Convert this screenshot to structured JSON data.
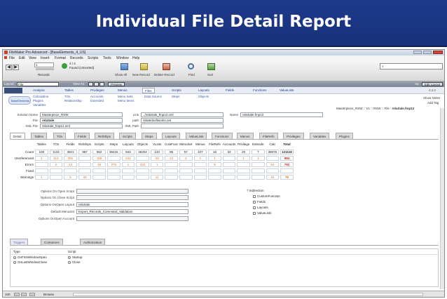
{
  "slide_title": "Individual File Detail Report",
  "window": {
    "title": "FileMaker Pro Advanced - [BaseElements_4_US]"
  },
  "menu": [
    "File",
    "Edit",
    "View",
    "Insert",
    "Format",
    "Records",
    "Scripts",
    "Tools",
    "Window",
    "Help"
  ],
  "toolbar": {
    "record_current": "1",
    "record_total": "4 / 4",
    "found_label": "Found (Unsorted)",
    "records_label": "Records",
    "buttons": [
      "Show All",
      "New Record",
      "Delete Record",
      "Find",
      "Sort"
    ]
  },
  "layoutbar": {
    "layout_label": "Layout:",
    "layout_value": "File",
    "viewas_label": "View As:",
    "preview_label": "Preview",
    "aa": "Aa",
    "edit_layout": "Edit Layout"
  },
  "nav": {
    "tabs": [
      "Analysis",
      "Tables",
      "Privileges",
      "Menus",
      "Files",
      "Scripts",
      "Layouts",
      "Fields",
      "Functions",
      "ValueLists"
    ],
    "sub": [
      [
        "Calculation",
        "Plugins",
        "Variables"
      ],
      [
        "TOs",
        "Relationship"
      ],
      [
        "Accounts",
        "Extended"
      ],
      [
        "Menu Sets",
        "Menu Items"
      ],
      [
        "Data Source"
      ],
      [
        "Steps"
      ],
      [
        "Objects"
      ]
    ],
    "version": "4.3.2",
    "show_notes": "Show Notes",
    "add_tag": "Add Tag",
    "path": "Masterpiece_RSW :: V1 :: RSW :: File : ",
    "path_file": "relaSale.fmp12",
    "logo": "BaseElements"
  },
  "info": {
    "solution_name_label": "Solution Name",
    "solution_name": "Masterpiece_RSW",
    "file_label": "File",
    "file": "relaSale",
    "xml_file_label": "XML File",
    "xml_file": "relaSale_fmp12.xml",
    "link_label": "Link",
    "link": "../relaSale_fmp12.xml",
    "name_label": "Name",
    "name": "relaSale.fmp12",
    "path_label": "path",
    "path": "relatedsoftworks.net",
    "xml_path_label": "XML Path",
    "xml_path": ""
  },
  "detail_tabs": [
    "Detail",
    "Tables",
    "TOs",
    "Fields",
    "RelShips",
    "Scripts",
    "Steps",
    "Layouts",
    "ValueLists",
    "Functions",
    "Menus",
    "FileRefs",
    "Privileges",
    "Variables",
    "Plugins"
  ],
  "stats": {
    "columns": [
      "Tables",
      "TOs",
      "Fields",
      "RelShips",
      "Scripts",
      "Steps",
      "Layouts",
      "Objects",
      "VLists",
      "CustFunc",
      "MenuSet",
      "Menus",
      "FileRefs",
      "Accounts",
      "Privilege",
      "Extende",
      "Calc",
      "Total"
    ],
    "rows": [
      {
        "label": "Count",
        "values": [
          "109",
          "1134",
          "3921",
          "987",
          "962",
          "38415",
          "843",
          "36204",
          "133",
          "86",
          "57",
          "107",
          "16",
          "32",
          "20",
          "7",
          "38076",
          "121119"
        ]
      },
      {
        "label": "Unreferenced",
        "values": [
          "1",
          "113",
          "391",
          "",
          "159",
          "",
          "244",
          "",
          "23",
          "13",
          "2",
          "1",
          "1",
          "",
          "1",
          "1",
          "",
          "984"
        ]
      },
      {
        "label": "Errors",
        "values": [
          "",
          "2",
          "13",
          "",
          "16",
          "275",
          "1",
          "422",
          "1",
          "",
          "",
          "",
          "8",
          "",
          "",
          "",
          "54",
          "792"
        ]
      },
      {
        "label": "Fixed",
        "values": [
          "",
          "",
          "",
          "",
          "",
          "",
          "",
          "",
          "",
          "",
          "",
          "",
          "",
          "",
          "",
          "",
          "",
          ""
        ]
      },
      {
        "label": "Warnings",
        "values": [
          "1",
          "",
          "5",
          "44",
          "",
          "",
          "",
          "",
          "11",
          "",
          "",
          "",
          "",
          "",
          "",
          "",
          "15",
          "76"
        ]
      }
    ]
  },
  "options": {
    "open_script_label": "Options On Open Script",
    "open_script": "",
    "close_script_label": "Options On Close Script",
    "close_script": "",
    "open_layout_label": "Options OnOpen Layout",
    "open_layout": "relaSale",
    "default_menu_label": "Default MenuSet",
    "default_menu": "Export_Records_Command_Validation",
    "open_account_label": "Options OnOpen Account",
    "open_account": ""
  },
  "indirection": {
    "title": "Indirection",
    "items": [
      "CustomFunction",
      "Fields",
      "Layouts",
      "ValueLists"
    ]
  },
  "bottom_tabs": [
    "Triggers",
    "Containers",
    "Authorization"
  ],
  "triggers": {
    "type_header": "Type",
    "script_header": "Script",
    "rows": [
      {
        "type": "OnFirstWindowOpen",
        "script": "Startup"
      },
      {
        "type": "OnLastWindowClose",
        "script": "Close"
      }
    ]
  },
  "status": {
    "zoom": "100",
    "mode": "Browse"
  }
}
